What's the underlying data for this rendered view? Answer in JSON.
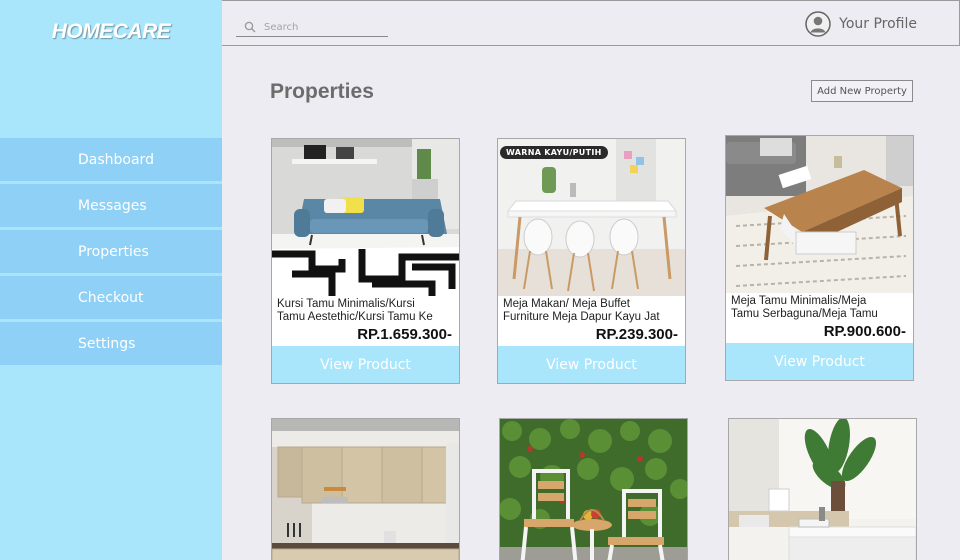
{
  "app": {
    "brand": "HOMECARE"
  },
  "sidebar": {
    "items": [
      {
        "label": "Dashboard"
      },
      {
        "label": "Messages"
      },
      {
        "label": "Properties"
      },
      {
        "label": "Checkout"
      },
      {
        "label": "Settings"
      }
    ]
  },
  "topbar": {
    "search_placeholder": "Search",
    "profile_label": "Your Profile"
  },
  "main": {
    "title": "Properties",
    "add_button": "Add New Property",
    "view_label": "View Product",
    "products": [
      {
        "desc1": "Kursi Tamu Minimalis/Kursi",
        "desc2": "Tamu Aestethic/Kursi Tamu Ke",
        "price": "RP.1.659.300-",
        "image": "sofa"
      },
      {
        "desc1": "Meja Makan/ Meja Buffet",
        "desc2": "Furniture Meja Dapur Kayu Jat",
        "price": "RP.239.300-",
        "image": "dining-table",
        "badge": "WARNA KAYU/PUTIH"
      },
      {
        "desc1": "Meja Tamu Minimalis/Meja",
        "desc2": "Tamu Serbaguna/Meja Tamu",
        "price": "RP.900.600-",
        "image": "coffee-table"
      },
      {
        "image": "kitchen"
      },
      {
        "image": "garden-chairs"
      },
      {
        "image": "living-table"
      }
    ]
  },
  "colors": {
    "sidebar": "#a9e6fb",
    "nav_item": "#8fd0f6",
    "background": "#ececf2",
    "button": "#a9e6fb"
  }
}
